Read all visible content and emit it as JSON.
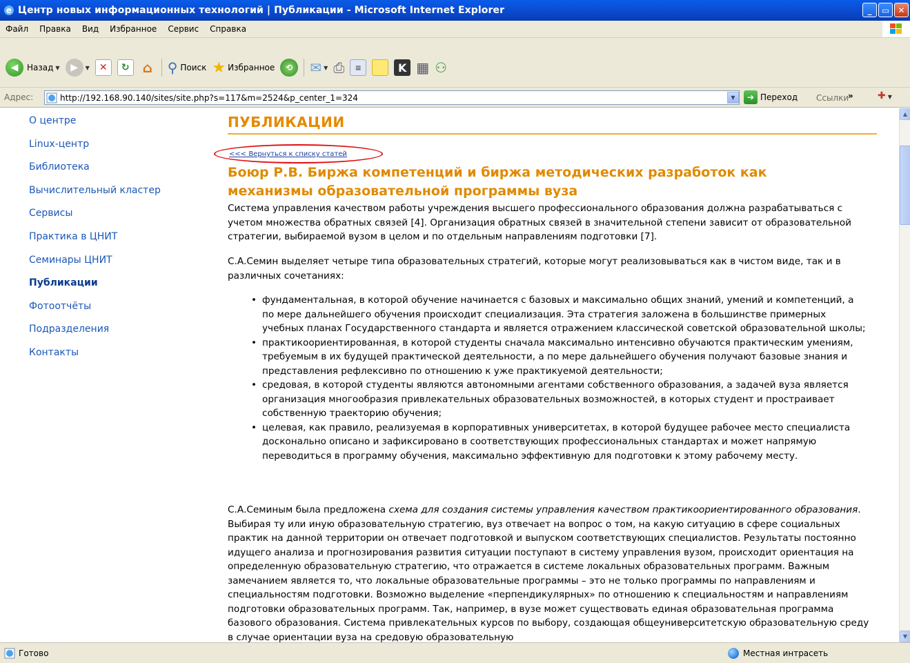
{
  "window": {
    "title": "Центр новых информационных технологий | Публикации - Microsoft Internet Explorer",
    "buttons": [
      "minimize",
      "maximize",
      "close"
    ]
  },
  "menu": [
    "Файл",
    "Правка",
    "Вид",
    "Избранное",
    "Сервис",
    "Справка"
  ],
  "toolbar": {
    "back_label": "Назад",
    "search_label": "Поиск",
    "favorites_label": "Избранное",
    "icons": [
      "back-icon",
      "forward-icon",
      "stop-icon",
      "refresh-icon",
      "home-icon",
      "search-icon",
      "favorites-star-icon",
      "history-icon",
      "mail-icon",
      "print-icon",
      "edit-icon",
      "note-icon",
      "messenger-icon",
      "research-icon",
      "contacts-icon"
    ]
  },
  "address": {
    "label": "Адрес:",
    "url": "http://192.168.90.140/sites/site.php?s=117&m=2524&p_center_1=324",
    "go_label": "Переход",
    "links_label": "Ссылки",
    "more": "»"
  },
  "sidebar": {
    "items": [
      {
        "label": "О центре"
      },
      {
        "label": "Linux-центр"
      },
      {
        "label": "Библиотека"
      },
      {
        "label": "Вычислительный кластер"
      },
      {
        "label": "Сервисы"
      },
      {
        "label": "Практика в ЦНИТ"
      },
      {
        "label": "Семинары ЦНИТ"
      },
      {
        "label": "Публикации",
        "active": true
      },
      {
        "label": "Фотоотчёты"
      },
      {
        "label": "Подразделения"
      },
      {
        "label": "Контакты"
      }
    ]
  },
  "main": {
    "section_title": "ПУБЛИКАЦИИ",
    "back_link": "<<< Вернуться к списку статей",
    "article_title": "Боюр Р.В. Биржа компетенций и биржа методических разработок как механизмы образовательной программы вуза",
    "p1": "Система управления качеством работы учреждения высшего профессионального образования должна разрабатываться с учетом множества обратных связей [4]. Организация обратных связей в значительной степени зависит от образовательной стратегии, выбираемой вузом в целом и по отдельным направлениям подготовки [7].",
    "p2": "С.А.Семин выделяет четыре типа образовательных стратегий, которые могут реализовываться как в чистом виде, так и в различных сочетаниях:",
    "bullets": [
      "фундаментальная, в которой обучение начинается с базовых и максимально общих знаний, умений и компетенций, а по мере дальнейшего обучения происходит специализация. Эта стратегия заложена в большинстве примерных учебных планах Государственного стандарта и является отражением классической советской образовательной школы;",
      "практикоориентированная, в которой студенты сначала максимально интенсивно обучаются практическим умениям, требуемым в их будущей практической деятельности, а по мере дальнейшего обучения получают базовые знания и представления рефлексивно по отношению к уже практикуемой деятельности;",
      "средовая, в которой студенты являются автономными агентами собственного образования, а задачей вуза является организация многообразия привлекательных образовательных возможностей, в которых студент и простраивает собственную траекторию обучения;",
      "целевая, как правило, реализуемая в корпоративных университетах, в которой будущее рабочее место специалиста досконально описано и зафиксировано в соответствующих профессиональных стандартах и может напрямую переводиться в программу обучения, максимально эффективную для подготовки к этому рабочему месту."
    ],
    "p3_start": "С.А.Семиным была предложена ",
    "p3_em": "схема для создания системы управления качеством практикоориентированного образования",
    "p3_rest": ". Выбирая ту или иную образовательную стратегию, вуз отвечает на вопрос о том, на какую ситуацию в сфере социальных практик на данной территории он отвечает подготовкой и выпуском соответствующих специалистов. Результаты постоянно идущего анализа и прогнозирования развития ситуации поступают в систему управления вузом, происходит ориентация на определенную образовательную стратегию, что отражается в системе локальных образовательных программ. Важным замечанием является то, что локальные образовательные программы – это не только программы по направлениям и специальностям подготовки. Возможно выделение «перпендикулярных» по отношению к специальностям и направлениям подготовки образовательных программ. Так, например, в вузе может существовать единая образовательная программа базового образования. Система привлекательных курсов по выбору, создающая общеуниверситетскую образовательную среду в случае ориентации вуза на средовую образовательную"
  },
  "status": {
    "text": "Готово",
    "zone": "Местная интрасеть"
  },
  "colors": {
    "accent_orange": "#e58a00",
    "link_blue": "#1a57b8",
    "titlebar_blue": "#0a4fd6"
  }
}
